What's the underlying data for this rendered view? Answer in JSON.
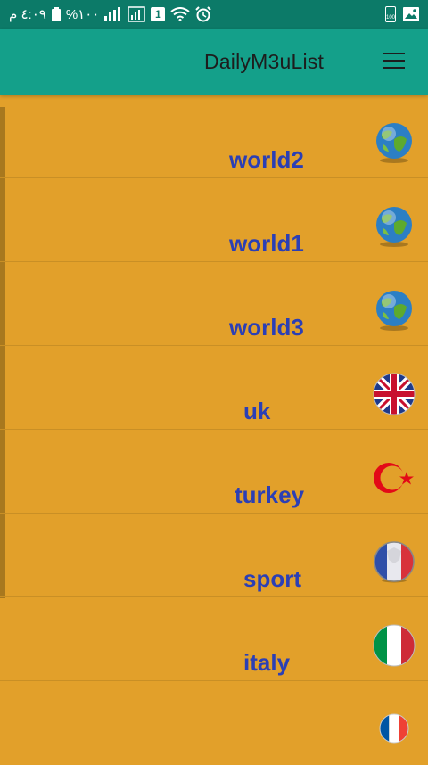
{
  "status_bar": {
    "time": "٤:٠٩ م",
    "battery_text": "%١٠٠",
    "sim_badge": "1",
    "battery_right": "100",
    "icons": [
      "battery-icon",
      "signal-icon",
      "sim-icon",
      "wifi-icon",
      "alarm-icon",
      "battery-saver-icon",
      "gallery-icon"
    ]
  },
  "app_bar": {
    "title": "DailyM3uList",
    "menu_icon": "menu-icon"
  },
  "list": {
    "items": [
      {
        "label": "world2",
        "icon": "globe-icon"
      },
      {
        "label": "world1",
        "icon": "globe-icon"
      },
      {
        "label": "world3",
        "icon": "globe-icon"
      },
      {
        "label": "uk",
        "icon": "uk-flag-icon"
      },
      {
        "label": "turkey",
        "icon": "turkey-flag-icon"
      },
      {
        "label": "sport",
        "icon": "sport-flag-icon"
      },
      {
        "label": "italy",
        "icon": "italy-flag-icon"
      },
      {
        "label": "",
        "icon": "france-flag-icon"
      }
    ]
  },
  "colors": {
    "status_bar": "#0C7A68",
    "app_bar": "#14A08A",
    "background": "#E2A02A",
    "label": "#2B3FB5",
    "divider": "#C98F25"
  }
}
